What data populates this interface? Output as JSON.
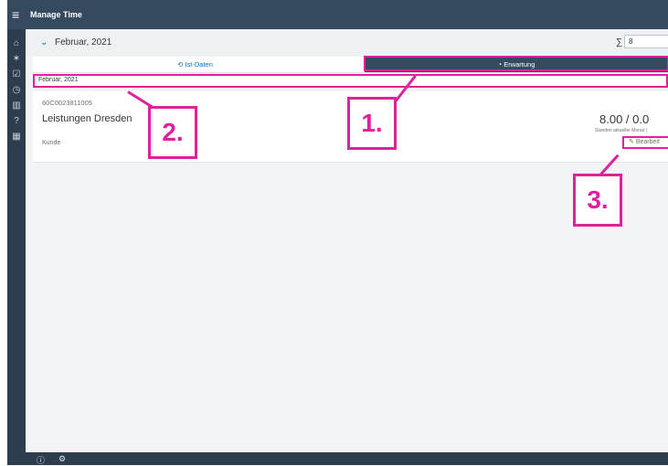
{
  "app": {
    "title": "Manage Time"
  },
  "sidebar": {
    "icons": [
      "home-icon",
      "runner-icon",
      "checkbox-icon",
      "clock-icon",
      "chart-icon",
      "help-icon",
      "calendar-icon"
    ]
  },
  "header": {
    "month_label": "Februar, 2021",
    "sigma": "∑",
    "sum_value": "8"
  },
  "tabs": [
    {
      "label": "Ist-Daten",
      "icon": "history-icon",
      "active": false
    },
    {
      "label": "Erwartung",
      "icon": "forecast-icon",
      "active": true
    }
  ],
  "filter": {
    "value": "Februar, 2021"
  },
  "card": {
    "code": "60C0023811005",
    "name": "Leistungen Dresden",
    "customer_label": "Kunde",
    "hours": "8.00 / 0.0",
    "hours_caption": "Stunden aktueller Monat (",
    "edit_label": "Bearbeit"
  },
  "annotations": [
    "1.",
    "2.",
    "3."
  ],
  "colors": {
    "accent": "#e0219e",
    "shell": "#354a5f",
    "brand": "#0a6ed1"
  }
}
